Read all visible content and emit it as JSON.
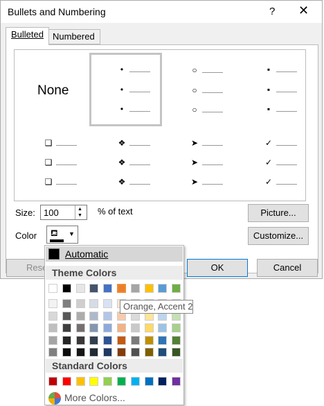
{
  "window": {
    "title": "Bullets and Numbering",
    "help": "?",
    "close": "✕"
  },
  "tabs": [
    {
      "label": "Bulleted",
      "active": true
    },
    {
      "label": "Numbered",
      "active": false
    }
  ],
  "gallery": {
    "none_label": "None",
    "selected": "dot-bullet",
    "cells": [
      {
        "id": "dot",
        "symbol": "•"
      },
      {
        "id": "circle",
        "symbol": "○"
      },
      {
        "id": "square",
        "symbol": "▪"
      },
      {
        "id": "box",
        "symbol": "❑"
      },
      {
        "id": "diamond-cross",
        "symbol": "❖"
      },
      {
        "id": "arrow",
        "symbol": "➤"
      },
      {
        "id": "check",
        "symbol": "✓"
      }
    ]
  },
  "size": {
    "label": "Size:",
    "value": "100",
    "unit_label": "% of text"
  },
  "color": {
    "label": "Color"
  },
  "buttons": {
    "picture": "Picture...",
    "customize": "Customize...",
    "reset": "Rese",
    "ok": "OK",
    "cancel": "Cancel"
  },
  "color_menu": {
    "automatic_label": "Automatic",
    "theme_label": "Theme Colors",
    "standard_label": "Standard Colors",
    "more_label": "More Colors...",
    "theme_top": [
      "#ffffff",
      "#000000",
      "#e7e6e6",
      "#44546a",
      "#4472c4",
      "#ed7d31",
      "#a5a5a5",
      "#ffc000",
      "#5b9bd5",
      "#70ad47"
    ],
    "theme_shades": [
      [
        "#f2f2f2",
        "#7f7f7f",
        "#d0cece",
        "#d6dce4",
        "#d9e2f3",
        "#fbe5d5",
        "#ededed",
        "#fff2cc",
        "#deeaf6",
        "#e2efd9"
      ],
      [
        "#d8d8d8",
        "#595959",
        "#aeabab",
        "#adb9ca",
        "#b4c6e7",
        "#f7cbac",
        "#dbdbdb",
        "#ffe598",
        "#bdd6ee",
        "#c5e0b3"
      ],
      [
        "#bfbfbf",
        "#3f3f3f",
        "#757070",
        "#8496b0",
        "#8eaadb",
        "#f4b183",
        "#c9c9c9",
        "#ffd965",
        "#9cc3e5",
        "#a8d08d"
      ],
      [
        "#a5a5a5",
        "#262626",
        "#3a3838",
        "#323f4f",
        "#2f5496",
        "#c55a11",
        "#7b7b7b",
        "#bf9000",
        "#2e75b5",
        "#538135"
      ],
      [
        "#7f7f7f",
        "#0c0c0c",
        "#171616",
        "#222a35",
        "#1f3864",
        "#843c0b",
        "#525252",
        "#7f6000",
        "#1e4e79",
        "#375623"
      ]
    ],
    "standard": [
      "#c00000",
      "#ff0000",
      "#ffc000",
      "#ffff00",
      "#92d050",
      "#00b050",
      "#00b0f0",
      "#0070c0",
      "#002060",
      "#7030a0"
    ],
    "highlighted": "#ed7d31"
  },
  "tooltip": "Orange, Accent 2"
}
